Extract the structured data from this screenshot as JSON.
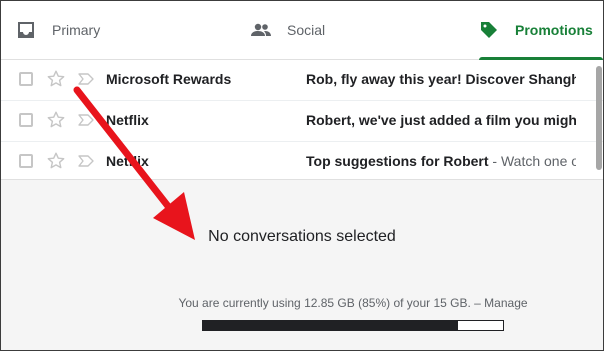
{
  "tabs": [
    {
      "label": "Primary",
      "icon": "inbox-icon",
      "active": false
    },
    {
      "label": "Social",
      "icon": "people-icon",
      "active": false
    },
    {
      "label": "Promotions",
      "icon": "tag-icon",
      "active": true
    }
  ],
  "emails": [
    {
      "sender": "Microsoft Rewards",
      "subject": "Rob, fly away this year! Discover Shanghai",
      "snippet": ""
    },
    {
      "sender": "Netflix",
      "subject": "Robert, we've just added a film you might li",
      "snippet": ""
    },
    {
      "sender": "Netflix",
      "subject": "Top suggestions for Robert",
      "snippet": " - Watch one of"
    }
  ],
  "preview": {
    "empty_message": "No conversations selected",
    "storage_text": "You are currently using 12.85 GB (85%) of your 15 GB. –",
    "manage_link": "Manage",
    "storage_percent": 85
  },
  "colors": {
    "accent_green": "#188038",
    "arrow_red": "#e8141c"
  }
}
